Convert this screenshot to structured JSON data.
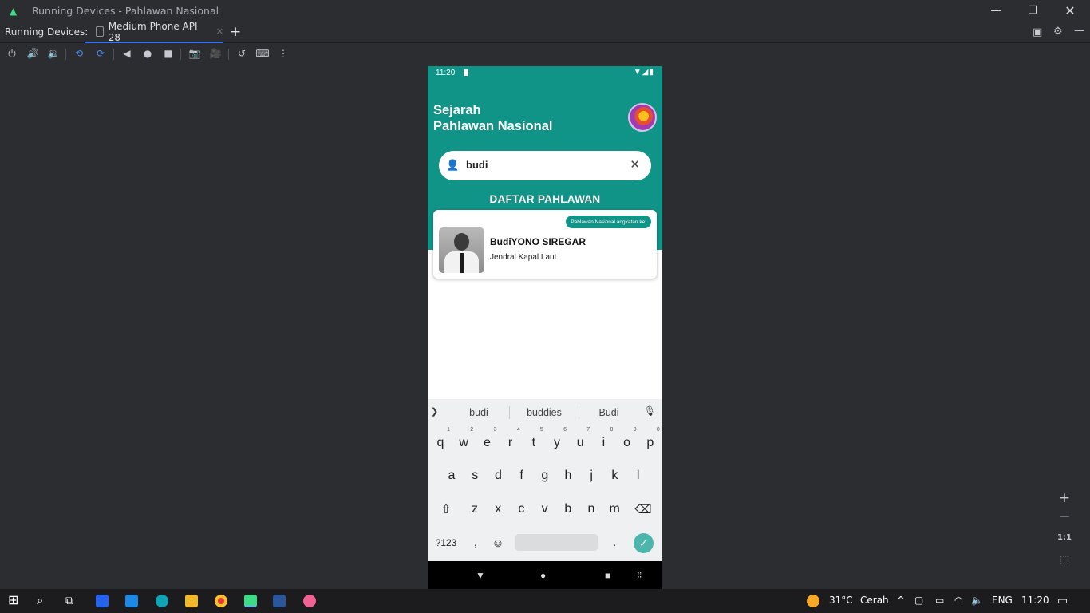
{
  "window": {
    "title": "Running Devices - Pahlawan Nasional"
  },
  "tabs": {
    "label": "Running Devices:",
    "device_tab": "Medium Phone API 28"
  },
  "phone": {
    "status_time": "11:20",
    "app_title_line1": "Sejarah",
    "app_title_line2": "Pahlawan Nasional",
    "search_value": "budi",
    "list_title": "DAFTAR PAHLAWAN",
    "card": {
      "badge": "Pahlawan Nasional angkatan ke:",
      "name": "BudiYONO SIREGAR",
      "rank": "Jendral Kapal Laut"
    },
    "suggestions": [
      "budi",
      "buddies",
      "Budi"
    ],
    "keys_row1": [
      {
        "k": "q",
        "n": "1"
      },
      {
        "k": "w",
        "n": "2"
      },
      {
        "k": "e",
        "n": "3"
      },
      {
        "k": "r",
        "n": "4"
      },
      {
        "k": "t",
        "n": "5"
      },
      {
        "k": "y",
        "n": "6"
      },
      {
        "k": "u",
        "n": "7"
      },
      {
        "k": "i",
        "n": "8"
      },
      {
        "k": "o",
        "n": "9"
      },
      {
        "k": "p",
        "n": "0"
      }
    ],
    "keys_row2": [
      "a",
      "s",
      "d",
      "f",
      "g",
      "h",
      "j",
      "k",
      "l"
    ],
    "keys_row3": [
      "z",
      "x",
      "c",
      "v",
      "b",
      "n",
      "m"
    ],
    "key_numsym": "?123",
    "key_comma": ",",
    "key_period": "."
  },
  "zoom": {
    "one_to_one": "1:1"
  },
  "taskbar": {
    "temperature": "31°C",
    "weather": "Cerah",
    "language": "ENG",
    "time": "11:20"
  },
  "icons": [
    "android-icon",
    "phone-icon",
    "power-icon",
    "volume-up-icon",
    "volume-down-icon",
    "rotate-left-icon",
    "rotate-right-icon",
    "back-icon",
    "home-icon",
    "overview-icon",
    "camera-icon",
    "video-icon",
    "reset-icon",
    "keyboard-icon",
    "more-icon",
    "search-person-icon",
    "close-icon",
    "mic-icon",
    "shift-icon",
    "backspace-icon",
    "emoji-icon",
    "check-icon",
    "windows-start-icon",
    "search-icon",
    "task-view-icon",
    "store-icon",
    "mail-icon",
    "edge-icon",
    "explorer-icon",
    "chrome-icon",
    "android-studio-icon",
    "word-icon",
    "paint-icon",
    "weather-icon",
    "wifi-icon",
    "speaker-icon"
  ]
}
